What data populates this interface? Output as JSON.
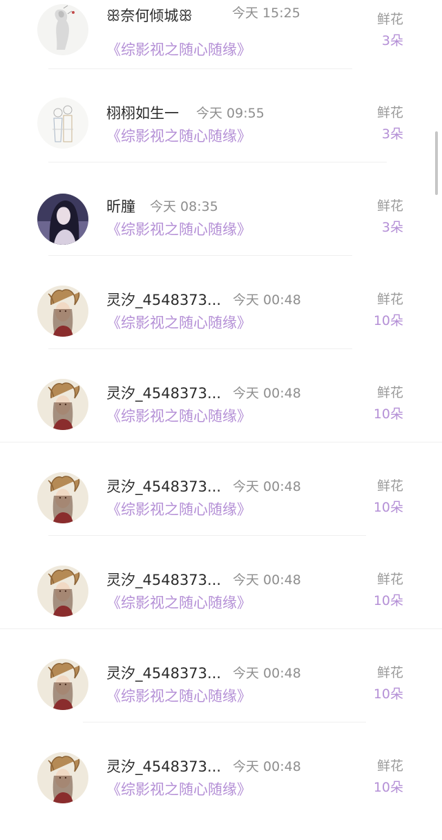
{
  "items": [
    {
      "name_prefix": "ꕥ",
      "name": "奈何倾城",
      "name_suffix": "ꕥ",
      "time": "今天 15:25",
      "book": "《综影视之随心随缘》",
      "gift_label": "鲜花",
      "gift_count": "3朵",
      "avatar": "ink-painting-avatar"
    },
    {
      "name": "栩栩如生一",
      "time": "今天 09:55",
      "book": "《综影视之随心随缘》",
      "gift_label": "鲜花",
      "gift_count": "3朵",
      "avatar": "sketch-couple-avatar"
    },
    {
      "name": "昕朣",
      "time": "今天 08:35",
      "book": "《综影视之随心随缘》",
      "gift_label": "鲜花",
      "gift_count": "3朵",
      "avatar": "dark-haired-girl-avatar"
    },
    {
      "name": "灵汐_4548373...",
      "time": "今天 00:48",
      "book": "《综影视之随心随缘》",
      "gift_label": "鲜花",
      "gift_count": "10朵",
      "avatar": "ancient-lady-avatar"
    },
    {
      "name": "灵汐_4548373...",
      "time": "今天 00:48",
      "book": "《综影视之随心随缘》",
      "gift_label": "鲜花",
      "gift_count": "10朵",
      "avatar": "ancient-lady-avatar"
    },
    {
      "name": "灵汐_4548373...",
      "time": "今天 00:48",
      "book": "《综影视之随心随缘》",
      "gift_label": "鲜花",
      "gift_count": "10朵",
      "avatar": "ancient-lady-avatar"
    },
    {
      "name": "灵汐_4548373...",
      "time": "今天 00:48",
      "book": "《综影视之随心随缘》",
      "gift_label": "鲜花",
      "gift_count": "10朵",
      "avatar": "ancient-lady-avatar"
    },
    {
      "name": "灵汐_4548373...",
      "time": "今天 00:48",
      "book": "《综影视之随心随缘》",
      "gift_label": "鲜花",
      "gift_count": "10朵",
      "avatar": "ancient-lady-avatar"
    },
    {
      "name": "灵汐_4548373...",
      "time": "今天 00:48",
      "book": "《综影视之随心随缘》",
      "gift_label": "鲜花",
      "gift_count": "10朵",
      "avatar": "ancient-lady-avatar"
    }
  ],
  "colors": {
    "name": "#2b2b2b",
    "time": "#8e8e8e",
    "book": "#b48fd6",
    "gift_label": "#9a9a9a",
    "gift_count": "#b48fd6",
    "divider": "#efefef"
  }
}
